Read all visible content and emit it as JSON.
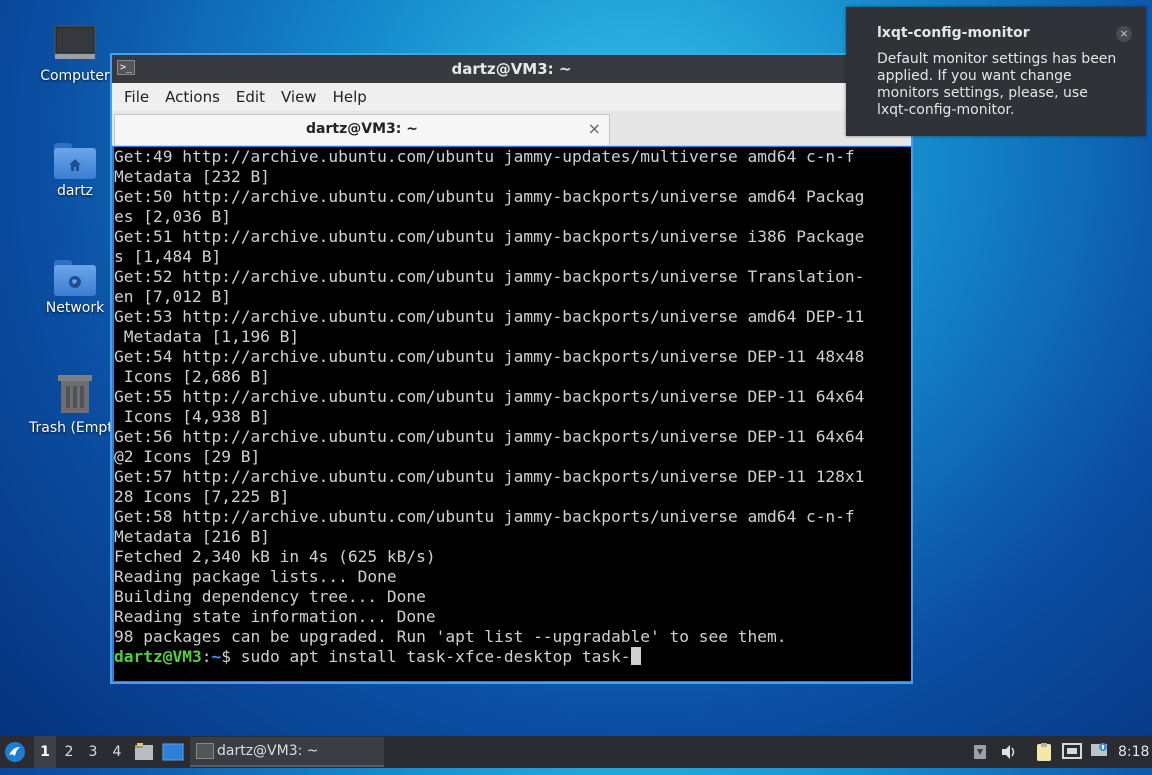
{
  "desktop": {
    "icons": [
      {
        "label": "Computer"
      },
      {
        "label": "dartz"
      },
      {
        "label": "Network"
      },
      {
        "label": "Trash (Empty)"
      }
    ]
  },
  "window": {
    "title": "dartz@VM3: ~",
    "menu": [
      "File",
      "Actions",
      "Edit",
      "View",
      "Help"
    ],
    "tab_label": "dartz@VM3: ~",
    "tab_close": "×"
  },
  "terminal": {
    "lines": [
      "Get:49 http://archive.ubuntu.com/ubuntu jammy-updates/multiverse amd64 c-n-f",
      "Metadata [232 B]",
      "Get:50 http://archive.ubuntu.com/ubuntu jammy-backports/universe amd64 Packag",
      "es [2,036 B]",
      "Get:51 http://archive.ubuntu.com/ubuntu jammy-backports/universe i386 Package",
      "s [1,484 B]",
      "Get:52 http://archive.ubuntu.com/ubuntu jammy-backports/universe Translation-",
      "en [7,012 B]",
      "Get:53 http://archive.ubuntu.com/ubuntu jammy-backports/universe amd64 DEP-11",
      " Metadata [1,196 B]",
      "Get:54 http://archive.ubuntu.com/ubuntu jammy-backports/universe DEP-11 48x48",
      " Icons [2,686 B]",
      "Get:55 http://archive.ubuntu.com/ubuntu jammy-backports/universe DEP-11 64x64",
      " Icons [4,938 B]",
      "Get:56 http://archive.ubuntu.com/ubuntu jammy-backports/universe DEP-11 64x64",
      "@2 Icons [29 B]",
      "Get:57 http://archive.ubuntu.com/ubuntu jammy-backports/universe DEP-11 128x1",
      "28 Icons [7,225 B]",
      "Get:58 http://archive.ubuntu.com/ubuntu jammy-backports/universe amd64 c-n-f",
      "Metadata [216 B]",
      "Fetched 2,340 kB in 4s (625 kB/s)",
      "Reading package lists... Done",
      "Building dependency tree... Done",
      "Reading state information... Done",
      "98 packages can be upgraded. Run 'apt list --upgradable' to see them."
    ],
    "prompt_user": "dartz@VM3",
    "prompt_sep": ":",
    "prompt_path": "~",
    "prompt_sign": "$ ",
    "command": "sudo apt install task-xfce-desktop task-"
  },
  "notification": {
    "title": "lxqt-config-monitor",
    "body": "Default monitor settings has been applied. If you want change monitors settings, please, use lxqt-config-monitor.",
    "close": "×"
  },
  "taskbar": {
    "desktops": [
      "1",
      "2",
      "3",
      "4"
    ],
    "task_label": "dartz@VM3: ~",
    "clock": "8:18"
  }
}
